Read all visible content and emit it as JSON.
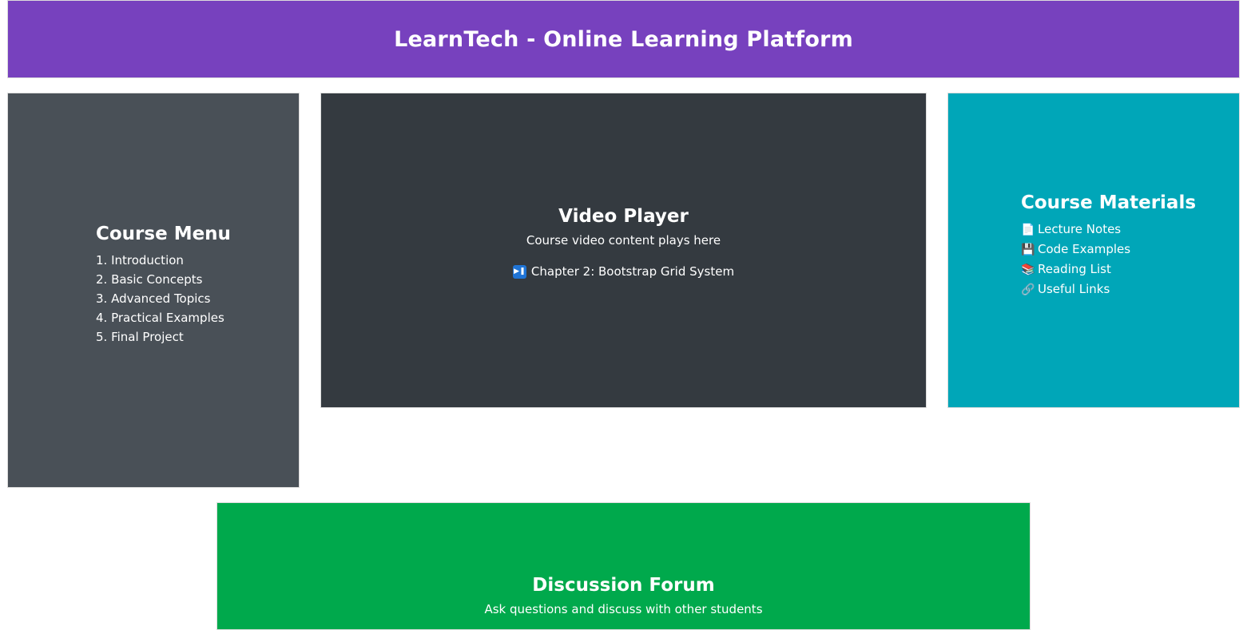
{
  "header": {
    "title": "LearnTech - Online Learning Platform"
  },
  "course_menu": {
    "title": "Course Menu",
    "items": [
      {
        "label": "1. Introduction"
      },
      {
        "label": "2. Basic Concepts"
      },
      {
        "label": "3. Advanced Topics"
      },
      {
        "label": "4. Practical Examples"
      },
      {
        "label": "5. Final Project"
      }
    ]
  },
  "video_player": {
    "title": "Video Player",
    "subtitle": "Course video content plays here",
    "chapter_icon": "play-pause-icon",
    "chapter": "Chapter 2: Bootstrap Grid System"
  },
  "course_materials": {
    "title": "Course Materials",
    "items": [
      {
        "icon": "document-icon",
        "glyph": "📄",
        "label": "Lecture Notes"
      },
      {
        "icon": "floppy-disk-icon",
        "glyph": "💾",
        "label": "Code Examples"
      },
      {
        "icon": "books-icon",
        "glyph": "📚",
        "label": "Reading List"
      },
      {
        "icon": "link-icon",
        "glyph": "🔗",
        "label": "Useful Links"
      }
    ]
  },
  "discussion_forum": {
    "title": "Discussion Forum",
    "subtitle": "Ask questions and discuss with other students"
  },
  "colors": {
    "header": "#7741be",
    "course_menu": "#495057",
    "video_player": "#343a40",
    "course_materials": "#00a6b8",
    "discussion_forum": "#00a94c"
  }
}
